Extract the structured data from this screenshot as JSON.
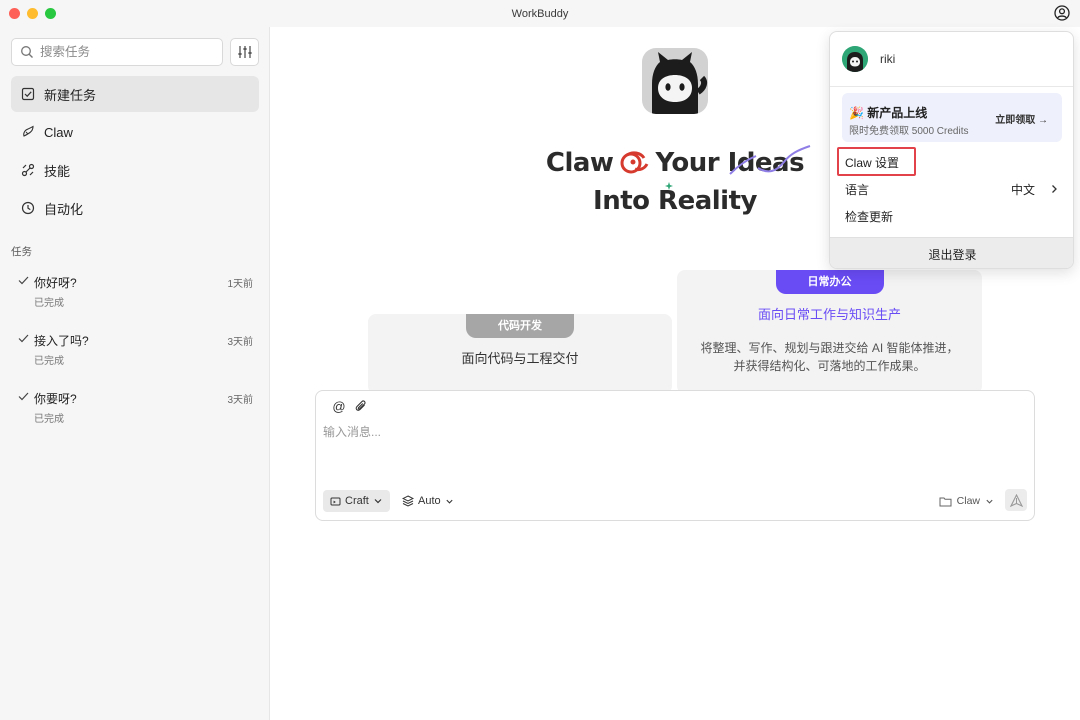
{
  "window": {
    "title": "WorkBuddy"
  },
  "sidebar": {
    "search_placeholder": "搜索任务",
    "nav": [
      {
        "label": "新建任务",
        "icon": "new-task-icon",
        "active": true
      },
      {
        "label": "Claw",
        "icon": "claw-icon",
        "active": false
      },
      {
        "label": "技能",
        "icon": "skills-icon",
        "active": false
      },
      {
        "label": "自动化",
        "icon": "clock-icon",
        "active": false
      }
    ],
    "tasks_title": "任务",
    "tasks": [
      {
        "name": "你好呀?",
        "status": "已完成",
        "time": "1天前"
      },
      {
        "name": "接入了吗?",
        "status": "已完成",
        "time": "3天前"
      },
      {
        "name": "你要呀?",
        "status": "已完成",
        "time": "3天前"
      }
    ]
  },
  "main": {
    "hero": {
      "line1_a": "Claw",
      "line1_b": "Your Ideas",
      "line2": "Into Reality"
    },
    "cards": [
      {
        "tab": "代码开发",
        "subtitle": "面向代码与工程交付"
      },
      {
        "tab": "日常办公",
        "subtitle": "面向日常工作与知识生产",
        "description": "将整理、写作、规划与跟进交给 AI 智能体推进，并获得结构化、可落地的工作成果。"
      }
    ],
    "composer": {
      "placeholder": "输入消息...",
      "mode": "Craft",
      "model": "Auto",
      "project": "Claw"
    }
  },
  "dropdown": {
    "username": "riki",
    "promo": {
      "title": "🎉 新产品上线",
      "desc": "限时免费领取 5000 Credits",
      "link": "立即领取 →"
    },
    "claw_settings": "Claw 设置",
    "language_label": "语言",
    "language_value": "中文",
    "check_update": "检查更新",
    "logout": "退出登录"
  },
  "colors": {
    "accent": "#6a4cf5",
    "highlight": "#e2434b",
    "avatar": "#2fa676"
  }
}
